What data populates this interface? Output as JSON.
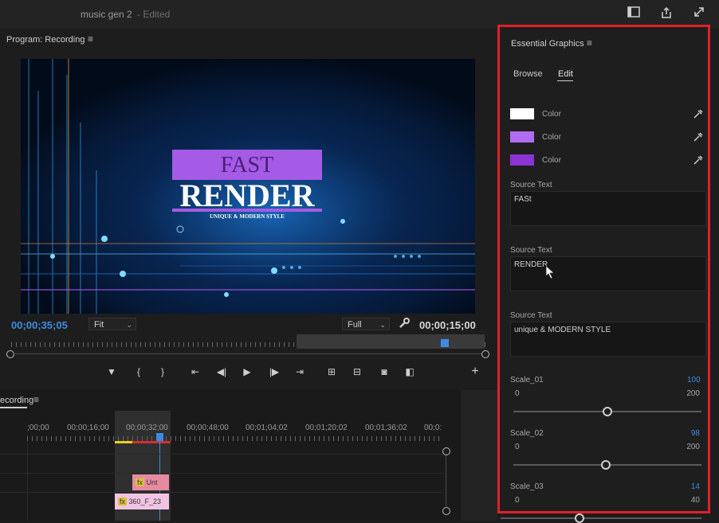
{
  "app": {
    "project_title": "music gen 2",
    "edited_label": "- Edited"
  },
  "program_monitor": {
    "panel_title": "Program: Recording",
    "current_timecode": "00;00;35;05",
    "fit_select": "Fit",
    "full_select": "Full",
    "duration_timecode": "00;00;15;00",
    "graphic": {
      "line1": "FAST",
      "line2": "RENDER",
      "line3": "UNIQUE & MODERN STYLE"
    }
  },
  "timeline": {
    "panel_title": "ecording",
    "ruler_labels": [
      ";00;00",
      "00;00;16;00",
      "00;00;32;00",
      "00;00;48;00",
      "00;01;04;02",
      "00;01;20;02",
      "00;01;36;02",
      "00;0:"
    ],
    "clips": [
      {
        "fx": "fx",
        "label": "Unt"
      },
      {
        "fx": "fx",
        "label": "360_F_23"
      }
    ]
  },
  "essential_graphics": {
    "panel_title": "Essential Graphics",
    "tabs": [
      "Browse",
      "Edit"
    ],
    "active_tab": "Edit",
    "colors": [
      {
        "label": "Color",
        "swatch": "#ffffff"
      },
      {
        "label": "Color",
        "swatch": "#b26cf0"
      },
      {
        "label": "Color",
        "swatch": "#8a34d4"
      }
    ],
    "source_texts": [
      {
        "label": "Source Text",
        "value": "FASt"
      },
      {
        "label": "Source Text",
        "value": "RENDER"
      },
      {
        "label": "Source Text",
        "value": "unique & MODERN STYLE"
      }
    ],
    "scales": [
      {
        "label": "Scale_01",
        "value": "100",
        "min": "0",
        "max": "200",
        "fraction": 0.5
      },
      {
        "label": "Scale_02",
        "value": "98",
        "min": "0",
        "max": "200",
        "fraction": 0.49
      },
      {
        "label": "Scale_03",
        "value": "14",
        "min": "0",
        "max": "40",
        "fraction": 0.35
      }
    ]
  },
  "icons": [
    "layout-icon",
    "export-icon",
    "maximize-icon",
    "eyedropper-icon",
    "wrench-icon",
    "marker-icon",
    "mark-in-icon",
    "mark-out-icon",
    "go-to-in-icon",
    "step-back-icon",
    "play-icon",
    "step-forward-icon",
    "go-to-out-icon",
    "lift-icon",
    "extract-icon",
    "camera-icon",
    "compare-icon",
    "add-icon"
  ],
  "colors": {
    "accent_blue": "#3d8be0",
    "highlight_red": "#e0202a"
  }
}
